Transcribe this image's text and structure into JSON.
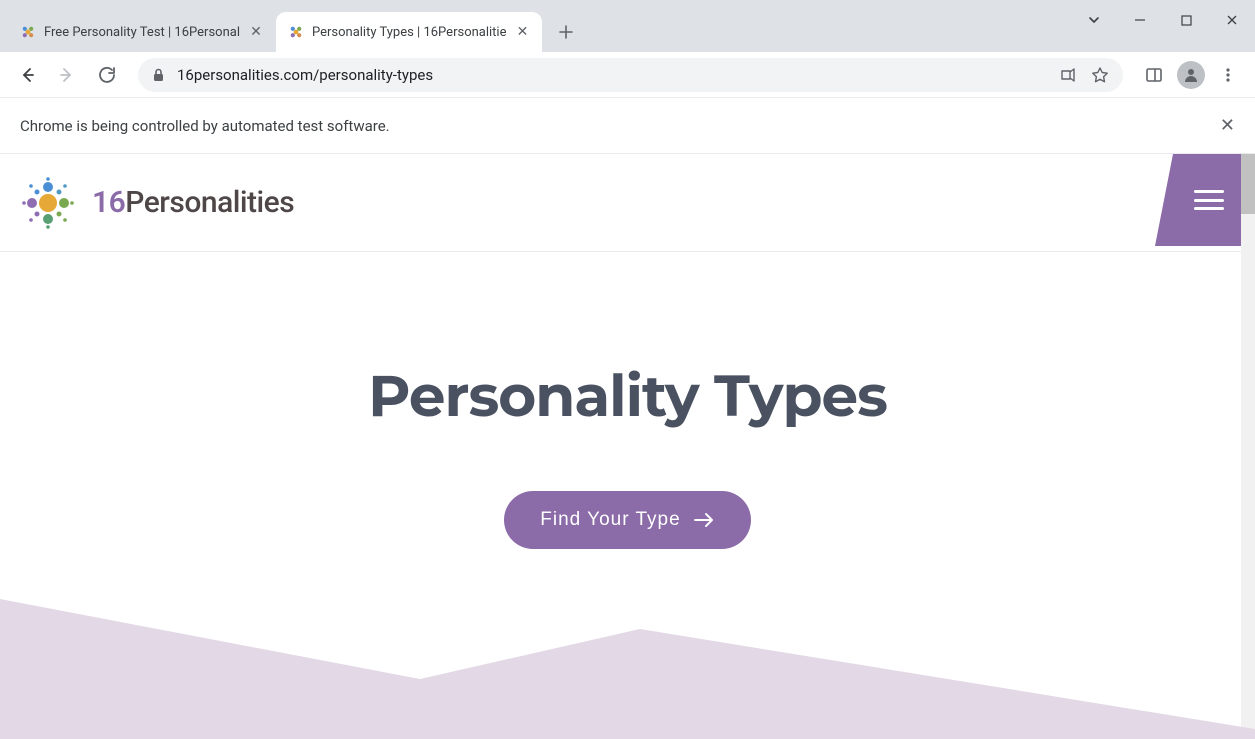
{
  "browser": {
    "tabs": [
      {
        "title": "Free Personality Test | 16Personal",
        "active": false
      },
      {
        "title": "Personality Types | 16Personalitie",
        "active": true
      }
    ],
    "url": "16personalities.com/personality-types",
    "infobar_text": "Chrome is being controlled by automated test software."
  },
  "site": {
    "logo_prefix": "16",
    "logo_suffix": "Personalities",
    "hero_title": "Personality Types",
    "cta_label": "Find Your Type"
  },
  "colors": {
    "brand_purple": "#8b6ba8",
    "heading": "#4a5161",
    "wave": "#e3d8e6"
  }
}
